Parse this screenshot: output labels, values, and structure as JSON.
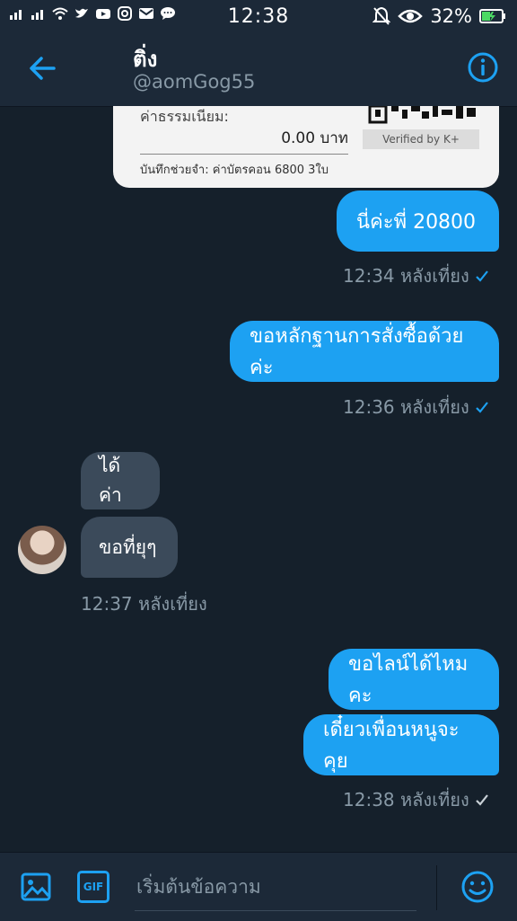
{
  "status_bar": {
    "time": "12:38",
    "battery": "32%",
    "icons": [
      "signal-icon",
      "signal-icon",
      "wifi-icon",
      "twitter-icon",
      "youtube-icon",
      "instagram-icon",
      "mail-icon",
      "chat-icon",
      "mute-bell-icon",
      "eye-icon",
      "battery-icon"
    ]
  },
  "header": {
    "name": "ติ่ง",
    "handle": "@aomGog55"
  },
  "receipt": {
    "fee_label": "ค่าธรรมเนียม:",
    "fee_amount": "0.00 บาท",
    "verified": "Verified by K+",
    "note": "บันทึกช่วยจำ: ค่าบัตรคอน 6800 3ใบ"
  },
  "messages": [
    {
      "dir": "out",
      "text": "นี่ค่ะพี่ 20800",
      "time": "12:34 หลังเที่ยง"
    },
    {
      "dir": "out",
      "text": "ขอหลักฐานการสั่งซื้อด้วยค่ะ",
      "time": "12:36 หลังเที่ยง"
    },
    {
      "dir": "in",
      "text": "ได้ค่า"
    },
    {
      "dir": "in",
      "text": "ขอที่ยุๆ",
      "time": "12:37 หลังเที่ยง"
    },
    {
      "dir": "out",
      "text": "ขอไลน์ได้ไหมคะ"
    },
    {
      "dir": "out",
      "text": "เดี๋ยวเพื่อนหนูจะคุย",
      "time": "12:38 หลังเที่ยง"
    }
  ],
  "composer": {
    "placeholder": "เริ่มต้นข้อความ",
    "gif_label": "GIF"
  },
  "colors": {
    "background": "#15202b",
    "bar": "#1c2938",
    "accent": "#1da1f2",
    "incoming": "#3b4a5a",
    "muted": "#8899a6"
  }
}
